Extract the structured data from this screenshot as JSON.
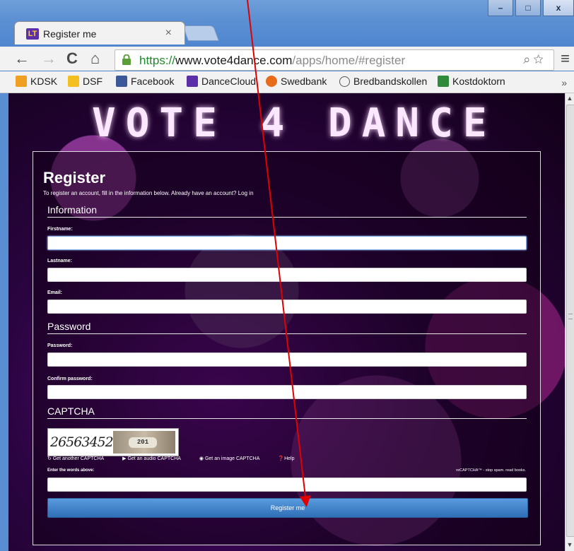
{
  "browser": {
    "tab_title": "Register me",
    "tab_close": "×",
    "url_scheme": "https://",
    "url_host": "www.vote4dance.com",
    "url_path": "/apps/home/#register",
    "window_buttons": [
      "–",
      "□",
      "x"
    ],
    "bookmarks": [
      {
        "label": "KDSK",
        "icon": "kdsk-icon",
        "color": "#f0a020"
      },
      {
        "label": "DSF",
        "icon": "dsf-icon",
        "color": "#f4c020"
      },
      {
        "label": "Facebook",
        "icon": "facebook-icon",
        "color": "#3b5998"
      },
      {
        "label": "DanceCloud",
        "icon": "dancecloud-icon",
        "color": "#5a2fa8"
      },
      {
        "label": "Swedbank",
        "icon": "swedbank-icon",
        "color": "#e86a1b"
      },
      {
        "label": "Bredbandskollen",
        "icon": "clock-icon",
        "color": "#555555"
      },
      {
        "label": "Kostdoktorn",
        "icon": "kostdoktorn-icon",
        "color": "#2f8a3a"
      }
    ],
    "bookmarks_more": "»"
  },
  "page": {
    "logo_text": "VOTE 4 DANCE",
    "title": "Register",
    "subtitle": "To register an account, fill in the information below. Already have an account? Log in",
    "sections": {
      "information": "Information",
      "password": "Password",
      "captcha": "CAPTCHA"
    },
    "fields": {
      "firstname_label": "Firstname:",
      "lastname_label": "Lastname:",
      "email_label": "Email:",
      "password_label": "Password:",
      "confirm_label": "Confirm password:",
      "captcha_label": "Enter the words above:"
    },
    "captcha": {
      "word": "26563452",
      "plate": "201",
      "links": [
        "Get another CAPTCHA",
        "Get an audio CAPTCHA",
        "Get an image CAPTCHA",
        "Help"
      ],
      "note": "reCAPTCHA™ - stop spam. read books."
    },
    "submit_label": "Register me"
  },
  "colors": {
    "accent_button": "#3a7cc4",
    "arrow": "#e00000"
  }
}
